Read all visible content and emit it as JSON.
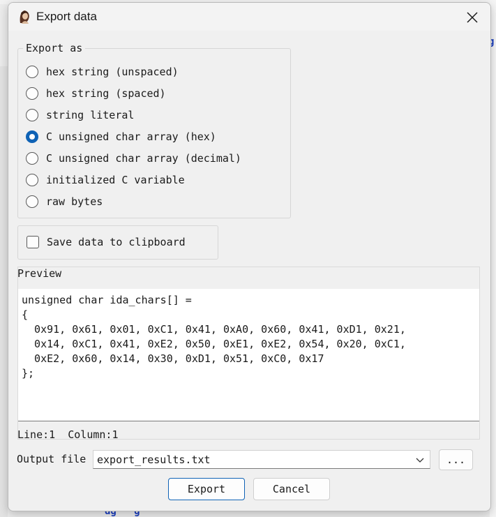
{
  "dialog": {
    "title": "Export data",
    "close_icon": "close-icon"
  },
  "export_as": {
    "legend": "Export as",
    "selected": "C unsigned char array (hex)",
    "options": [
      {
        "label": "hex string (unspaced)",
        "checked": false
      },
      {
        "label": "hex string (spaced)",
        "checked": false
      },
      {
        "label": "string literal",
        "checked": false
      },
      {
        "label": "C unsigned char array (hex)",
        "checked": true
      },
      {
        "label": "C unsigned char array (decimal)",
        "checked": false
      },
      {
        "label": "initialized C variable",
        "checked": false
      },
      {
        "label": "raw bytes",
        "checked": false
      }
    ]
  },
  "clipboard": {
    "label": "Save data to clipboard",
    "checked": false
  },
  "preview": {
    "label": "Preview",
    "lines": [
      "unsigned char ida_chars[] =",
      "{",
      "  0x91, 0x61, 0x01, 0xC1, 0x41, 0xA0, 0x60, 0x41, 0xD1, 0x21,",
      "  0x14, 0xC1, 0x41, 0xE2, 0x50, 0xE1, 0xE2, 0x54, 0x20, 0xC1,",
      "  0xE2, 0x60, 0x14, 0x30, 0xD1, 0x51, 0xC0, 0x17",
      "};"
    ],
    "status": "Line:1  Column:1"
  },
  "output": {
    "label": "Output file",
    "value": "export_results.txt",
    "browse_label": "..."
  },
  "buttons": {
    "export": "Export",
    "cancel": "Cancel"
  },
  "colors": {
    "accent": "#0f62b5",
    "dialog_bg": "#f0f0f0"
  }
}
